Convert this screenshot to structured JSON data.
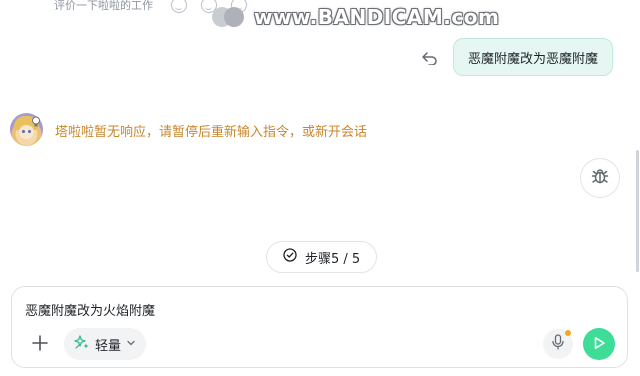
{
  "rating": {
    "text": "评价一下啦啦的工作",
    "icons": [
      "smile-icon",
      "neutral-face-icon",
      "sad-face-icon"
    ]
  },
  "watermark": {
    "text": "www.BANDICAM.com"
  },
  "user_message": {
    "text": "恶魔附魔改为恶魔附魔"
  },
  "assistant_message": {
    "text": "塔啦啦暂无响应，请暂停后重新输入指令，或新开会话"
  },
  "step_indicator": {
    "label": "步骤5 / 5"
  },
  "composer": {
    "input_value": "恶魔附魔改为火焰附魔",
    "mode_label": "轻量"
  },
  "colors": {
    "accent_green": "#3ddc97",
    "user_bubble_bg": "#e6f7f3",
    "warning_text": "#c8862a",
    "notification_dot": "#f5a623"
  }
}
